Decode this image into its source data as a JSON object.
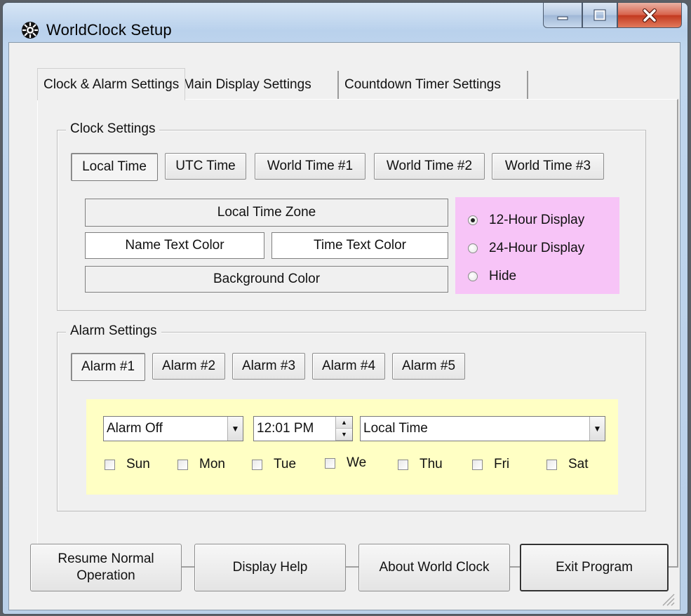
{
  "window": {
    "title": "WorldClock Setup",
    "icon": "clock-icon"
  },
  "tabs": [
    {
      "label": "Clock & Alarm Settings",
      "active": true
    },
    {
      "label": "Main Display Settings",
      "active": false
    },
    {
      "label": "Countdown Timer Settings",
      "active": false
    }
  ],
  "clock_settings": {
    "title": "Clock Settings",
    "buttons": [
      "Local Time",
      "UTC Time",
      "World Time #1",
      "World Time #2",
      "World Time #3"
    ],
    "selected": "Local Time",
    "time_zone_label": "Local Time Zone",
    "name_color_label": "Name Text Color",
    "time_color_label": "Time Text Color",
    "background_color_label": "Background Color",
    "display_options": [
      "12-Hour Display",
      "24-Hour Display",
      "Hide"
    ],
    "display_selected": "12-Hour Display",
    "accent_color": "#f7c4f7"
  },
  "alarm_settings": {
    "title": "Alarm Settings",
    "buttons": [
      "Alarm #1",
      "Alarm #2",
      "Alarm #3",
      "Alarm #4",
      "Alarm #5"
    ],
    "selected": "Alarm #1",
    "mode_value": "Alarm Off",
    "time_value": "12:01 PM",
    "zone_value": "Local Time",
    "days": [
      "Sun",
      "Mon",
      "Tue",
      "We",
      "Thu",
      "Fri",
      "Sat"
    ],
    "accent_color": "#ffffc4"
  },
  "footer": {
    "resume_line1": "Resume Normal",
    "resume_line2": "Operation",
    "help": "Display Help",
    "about": "About World Clock",
    "exit": "Exit Program"
  }
}
